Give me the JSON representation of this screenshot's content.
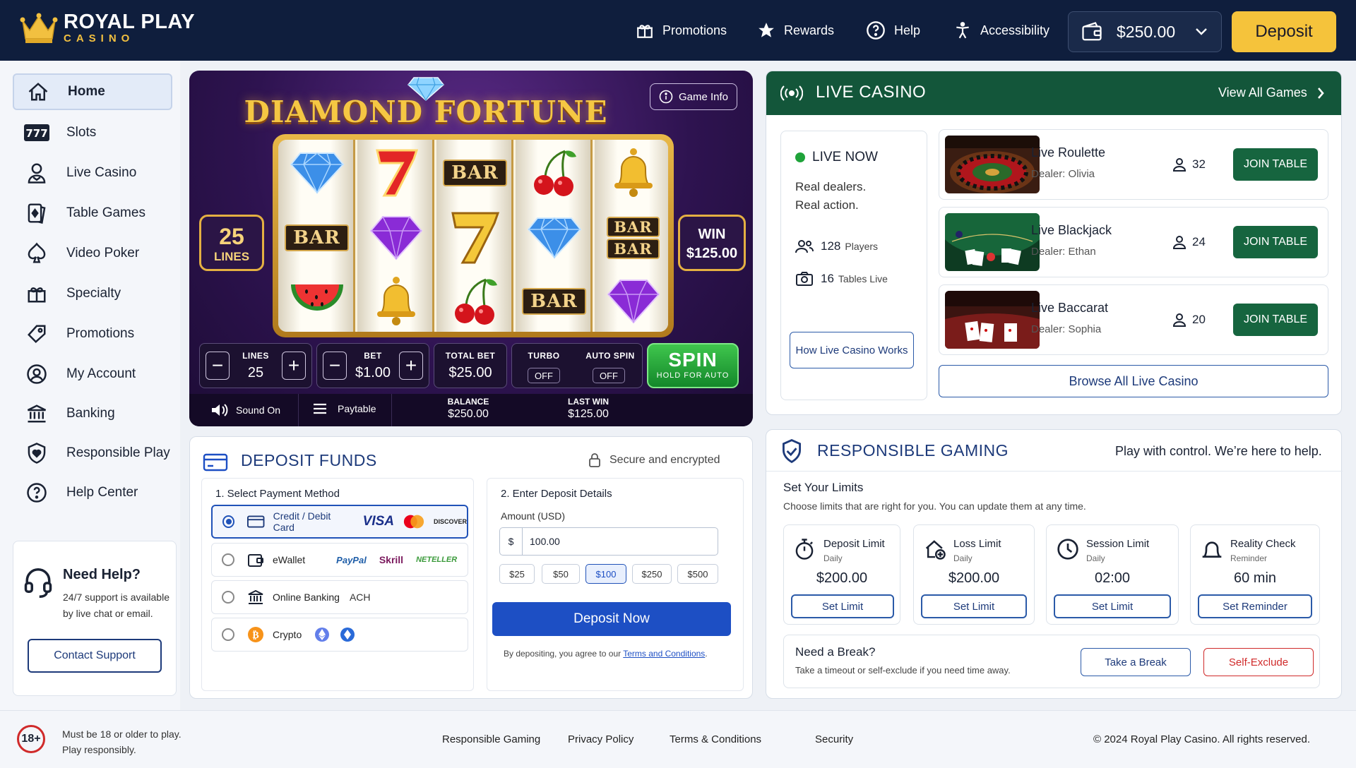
{
  "header": {
    "brand_line1": "ROYAL PLAY",
    "brand_line2": "CASINO",
    "nav": [
      {
        "label": "Promotions",
        "icon": "gift-icon"
      },
      {
        "label": "Rewards",
        "icon": "star-icon"
      },
      {
        "label": "Help",
        "icon": "question-icon"
      },
      {
        "label": "Accessibility",
        "icon": "accessibility-icon"
      }
    ],
    "balance": "$250.00",
    "deposit_label": "Deposit"
  },
  "sidebar": {
    "items": [
      {
        "label": "Home",
        "icon": "home-icon",
        "active": true
      },
      {
        "label": "Slots",
        "icon": "slots-777-icon"
      },
      {
        "label": "Live Casino",
        "icon": "dealer-icon"
      },
      {
        "label": "Table Games",
        "icon": "cards-icon"
      },
      {
        "label": "Video Poker",
        "icon": "spade-icon"
      },
      {
        "label": "Specialty",
        "icon": "gift-icon"
      },
      {
        "label": "Promotions",
        "icon": "tag-icon"
      },
      {
        "label": "My Account",
        "icon": "user-circle-icon"
      },
      {
        "label": "Banking",
        "icon": "bank-icon"
      },
      {
        "label": "Responsible Play",
        "icon": "shield-heart-icon"
      },
      {
        "label": "Help Center",
        "icon": "question-circle-icon"
      }
    ],
    "help": {
      "title": "Need Help?",
      "text1": "24/7 support is available",
      "text2": "by live chat or email.",
      "button": "Contact Support"
    }
  },
  "slot": {
    "title": "DIAMOND FORTUNE",
    "game_info": "Game Info",
    "lines_value": "25",
    "lines_label": "LINES",
    "win_label": "WIN",
    "win_value": "$125.00",
    "reels": [
      [
        "diamond",
        "bar",
        "watermelon"
      ],
      [
        "seven",
        "amethyst",
        "bell"
      ],
      [
        "bar",
        "seven",
        "cherry"
      ],
      [
        "cherry",
        "diamond",
        "bar"
      ],
      [
        "bell",
        "double-bar",
        "amethyst"
      ]
    ],
    "bar_text": "BAR",
    "controls": {
      "lines_label": "LINES",
      "lines_value": "25",
      "bet_label": "BET",
      "bet_value": "$1.00",
      "total_bet_label": "TOTAL BET",
      "total_bet_value": "$25.00",
      "turbo_label": "TURBO",
      "turbo_value": "OFF",
      "autospin_label": "AUTO SPIN",
      "autospin_value": "OFF",
      "minus": "−",
      "plus": "+",
      "spin_label": "SPIN",
      "spin_sub": "HOLD FOR AUTO"
    },
    "bottom": {
      "sound": "Sound On",
      "paytable": "Paytable",
      "balance_label": "BALANCE",
      "balance_value": "$250.00",
      "lastwin_label": "LAST WIN",
      "lastwin_value": "$125.00"
    }
  },
  "live": {
    "title": "LIVE CASINO",
    "view_all": "View All Games",
    "now_title": "LIVE NOW",
    "now_text1": "Real dealers.",
    "now_text2": "Real action.",
    "players_count": "128",
    "players_label": "Players",
    "tables_count": "16",
    "tables_label": "Tables Live",
    "how_button": "How Live Casino Works",
    "tables": [
      {
        "name": "Live Roulette",
        "dealer": "Dealer: Olivia",
        "players": "32",
        "button": "JOIN TABLE"
      },
      {
        "name": "Live Blackjack",
        "dealer": "Dealer: Ethan",
        "players": "24",
        "button": "JOIN TABLE"
      },
      {
        "name": "Live Baccarat",
        "dealer": "Dealer: Sophia",
        "players": "20",
        "button": "JOIN TABLE"
      }
    ],
    "browse_button": "Browse All Live Casino"
  },
  "deposit": {
    "title": "DEPOSIT FUNDS",
    "secure": "Secure and encrypted",
    "step1": "1.  Select Payment Method",
    "methods": [
      {
        "label": "Credit / Debit Card",
        "selected": true,
        "brands": [
          "VISA",
          "DISCOVER"
        ]
      },
      {
        "label": "eWallet",
        "selected": false,
        "brands": [
          "PayPal",
          "Skrill",
          "NETELLER"
        ]
      },
      {
        "label": "Online Banking",
        "selected": false,
        "brands": [
          "ACH"
        ]
      },
      {
        "label": "Crypto",
        "selected": false,
        "brands": []
      }
    ],
    "step2": "2.  Enter Deposit Details",
    "amount_label": "Amount (USD)",
    "currency": "$",
    "amount_value": "100.00",
    "quick": [
      "$25",
      "$50",
      "$100",
      "$250",
      "$500"
    ],
    "quick_selected": "$100",
    "submit": "Deposit Now",
    "terms_prefix": "By depositing, you agree to our ",
    "terms_link": "Terms and Conditions",
    "terms_suffix": "."
  },
  "responsible": {
    "title": "RESPONSIBLE GAMING",
    "tagline": "Play with control. We’re here to help.",
    "set_title": "Set Your Limits",
    "set_sub": "Choose limits that are right for you. You can update them at any time.",
    "limits": [
      {
        "title": "Deposit Limit",
        "sub": "Daily",
        "value": "$200.00",
        "button": "Set Limit",
        "icon": "stopwatch-icon"
      },
      {
        "title": "Loss Limit",
        "sub": "Daily",
        "value": "$200.00",
        "button": "Set Limit",
        "icon": "house-plus-icon"
      },
      {
        "title": "Session Limit",
        "sub": "Daily",
        "value": "02:00",
        "button": "Set Limit",
        "icon": "clock-icon"
      },
      {
        "title": "Reality Check",
        "sub": "Reminder",
        "value": "60 min",
        "button": "Set Reminder",
        "icon": "bell-outline-icon"
      }
    ],
    "break_title": "Need a Break?",
    "break_sub": "Take a timeout or self-exclude if you need time away.",
    "take_break": "Take a Break",
    "self_exclude": "Self-Exclude"
  },
  "footer": {
    "age_badge": "18+",
    "age_line1": "Must be 18 or older to play.",
    "age_line2": "Play responsibly.",
    "links": [
      "Responsible Gaming",
      "Privacy Policy",
      "Terms & Conditions",
      "Security"
    ],
    "copyright": "© 2024 Royal Play Casino. All rights reserved."
  },
  "colors": {
    "header_bg": "#0f1e3d",
    "accent_gold": "#f5c33b",
    "live_green": "#13563a",
    "primary_blue": "#1d4fc4",
    "danger_red": "#d02a2a"
  }
}
